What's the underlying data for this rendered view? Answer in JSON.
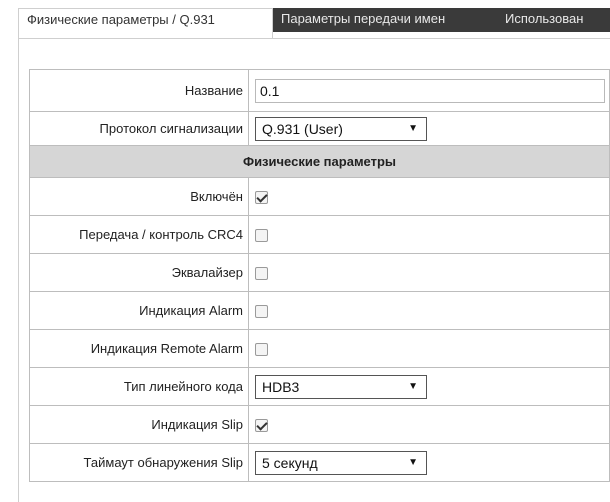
{
  "tabs": [
    {
      "label": "Физические параметры / Q.931",
      "active": true
    },
    {
      "label": "Параметры передачи имен",
      "active": false
    },
    {
      "label": "Использован",
      "active": false
    }
  ],
  "form": {
    "name_label": "Название",
    "name_value": "0.1",
    "protocol_label": "Протокол сигнализации",
    "protocol_value": "Q.931 (User)",
    "section_title": "Физические параметры",
    "enabled_label": "Включён",
    "enabled_checked": true,
    "crc4_label": "Передача / контроль CRC4",
    "crc4_checked": false,
    "equalizer_label": "Эквалайзер",
    "equalizer_checked": false,
    "alarm_label": "Индикация Alarm",
    "alarm_checked": false,
    "remote_alarm_label": "Индикация Remote Alarm",
    "remote_alarm_checked": false,
    "line_code_label": "Тип линейного кода",
    "line_code_value": "HDB3",
    "slip_label": "Индикация Slip",
    "slip_checked": true,
    "slip_timeout_label": "Таймаут обнаружения Slip",
    "slip_timeout_value": "5 секунд"
  },
  "icons": {
    "dropdown": "triangle-down-icon",
    "check": "checkmark-icon"
  }
}
